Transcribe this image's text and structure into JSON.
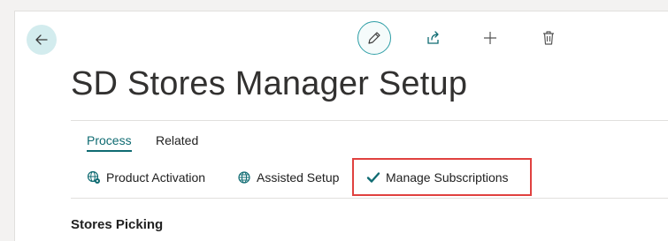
{
  "header": {
    "title": "SD Stores Manager Setup"
  },
  "toolbar": {
    "back_icon": "arrow-left-icon",
    "edit_icon": "pencil-icon",
    "share_icon": "share-icon",
    "add_icon": "plus-icon",
    "delete_icon": "trash-icon"
  },
  "tabs": [
    {
      "label": "Process"
    },
    {
      "label": "Related"
    }
  ],
  "actions": [
    {
      "label": "Product Activation",
      "icon": "globe-gear-icon"
    },
    {
      "label": "Assisted Setup",
      "icon": "globe-icon"
    },
    {
      "label": "Manage Subscriptions",
      "icon": "checkmark-icon"
    }
  ],
  "section": {
    "title": "Stores Picking"
  },
  "colors": {
    "accent": "#0f6b72",
    "highlight": "#e0413f",
    "back_bg": "#d3ecee",
    "check": "#0f6b72"
  }
}
